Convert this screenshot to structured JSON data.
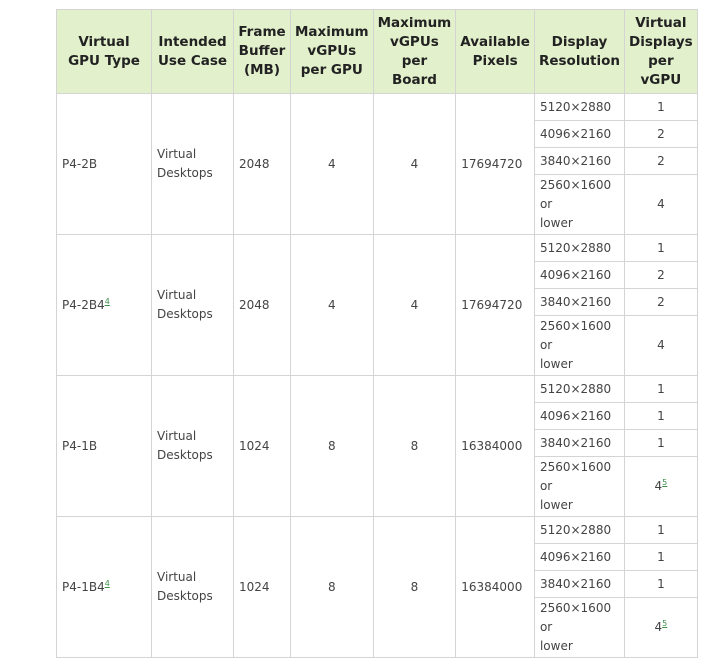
{
  "table": {
    "headers": [
      "Virtual GPU Type",
      "Intended Use Case",
      "Frame Buffer (MB)",
      "Maximum vGPUs per GPU",
      "Maximum vGPUs per Board",
      "Available Pixels",
      "Display Resolution",
      "Virtual Displays per vGPU"
    ],
    "header_lines": [
      [
        "Virtual",
        "GPU Type"
      ],
      [
        "Intended",
        "Use Case"
      ],
      [
        "Frame",
        "Buffer",
        "(MB)"
      ],
      [
        "Maximum",
        "vGPUs",
        "per GPU"
      ],
      [
        "Maximum",
        "vGPUs",
        "per",
        "Board"
      ],
      [
        "Available",
        "Pixels"
      ],
      [
        "Display",
        "Resolution"
      ],
      [
        "Virtual",
        "Displays",
        "per",
        "vGPU"
      ]
    ],
    "rows": [
      {
        "type": "P4-2B",
        "type_footnote": "",
        "use_case": [
          "Virtual",
          "Desktops"
        ],
        "frame_buffer": "2048",
        "max_per_gpu": "4",
        "max_per_board": "4",
        "pixels": "17694720",
        "resolutions": [
          {
            "res": "5120×2880",
            "displays": "1",
            "fn": ""
          },
          {
            "res": "4096×2160",
            "displays": "2",
            "fn": ""
          },
          {
            "res": "3840×2160",
            "displays": "2",
            "fn": ""
          },
          {
            "res": "2560×1600 or lower",
            "displays": "4",
            "fn": ""
          }
        ]
      },
      {
        "type": "P4-2B4",
        "type_footnote": "4",
        "use_case": [
          "Virtual",
          "Desktops"
        ],
        "frame_buffer": "2048",
        "max_per_gpu": "4",
        "max_per_board": "4",
        "pixels": "17694720",
        "resolutions": [
          {
            "res": "5120×2880",
            "displays": "1",
            "fn": ""
          },
          {
            "res": "4096×2160",
            "displays": "2",
            "fn": ""
          },
          {
            "res": "3840×2160",
            "displays": "2",
            "fn": ""
          },
          {
            "res": "2560×1600 or lower",
            "displays": "4",
            "fn": ""
          }
        ]
      },
      {
        "type": "P4-1B",
        "type_footnote": "",
        "use_case": [
          "Virtual",
          "Desktops"
        ],
        "frame_buffer": "1024",
        "max_per_gpu": "8",
        "max_per_board": "8",
        "pixels": "16384000",
        "resolutions": [
          {
            "res": "5120×2880",
            "displays": "1",
            "fn": ""
          },
          {
            "res": "4096×2160",
            "displays": "1",
            "fn": ""
          },
          {
            "res": "3840×2160",
            "displays": "1",
            "fn": ""
          },
          {
            "res": "2560×1600 or lower",
            "displays": "4",
            "fn": "5"
          }
        ]
      },
      {
        "type": "P4-1B4",
        "type_footnote": "4",
        "use_case": [
          "Virtual",
          "Desktops"
        ],
        "frame_buffer": "1024",
        "max_per_gpu": "8",
        "max_per_board": "8",
        "pixels": "16384000",
        "resolutions": [
          {
            "res": "5120×2880",
            "displays": "1",
            "fn": ""
          },
          {
            "res": "4096×2160",
            "displays": "1",
            "fn": ""
          },
          {
            "res": "3840×2160",
            "displays": "1",
            "fn": ""
          },
          {
            "res": "2560×1600 or lower",
            "displays": "4",
            "fn": "5"
          }
        ]
      }
    ]
  }
}
